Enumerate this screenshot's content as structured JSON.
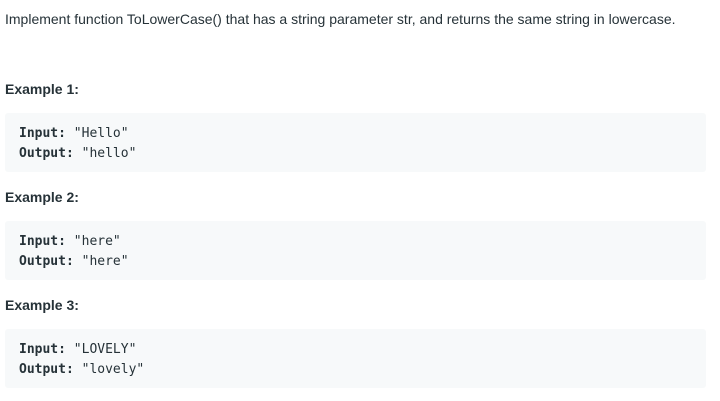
{
  "description": "Implement function ToLowerCase() that has a string parameter str, and returns the same string in lowercase.",
  "examples": [
    {
      "heading": "Example 1:",
      "input_label": "Input:",
      "input_value": " \"Hello\"",
      "output_label": "Output:",
      "output_value": " \"hello\""
    },
    {
      "heading": "Example 2:",
      "input_label": "Input:",
      "input_value": " \"here\"",
      "output_label": "Output:",
      "output_value": " \"here\""
    },
    {
      "heading": "Example 3:",
      "input_label": "Input:",
      "input_value": " \"LOVELY\"",
      "output_label": "Output:",
      "output_value": " \"lovely\""
    }
  ]
}
